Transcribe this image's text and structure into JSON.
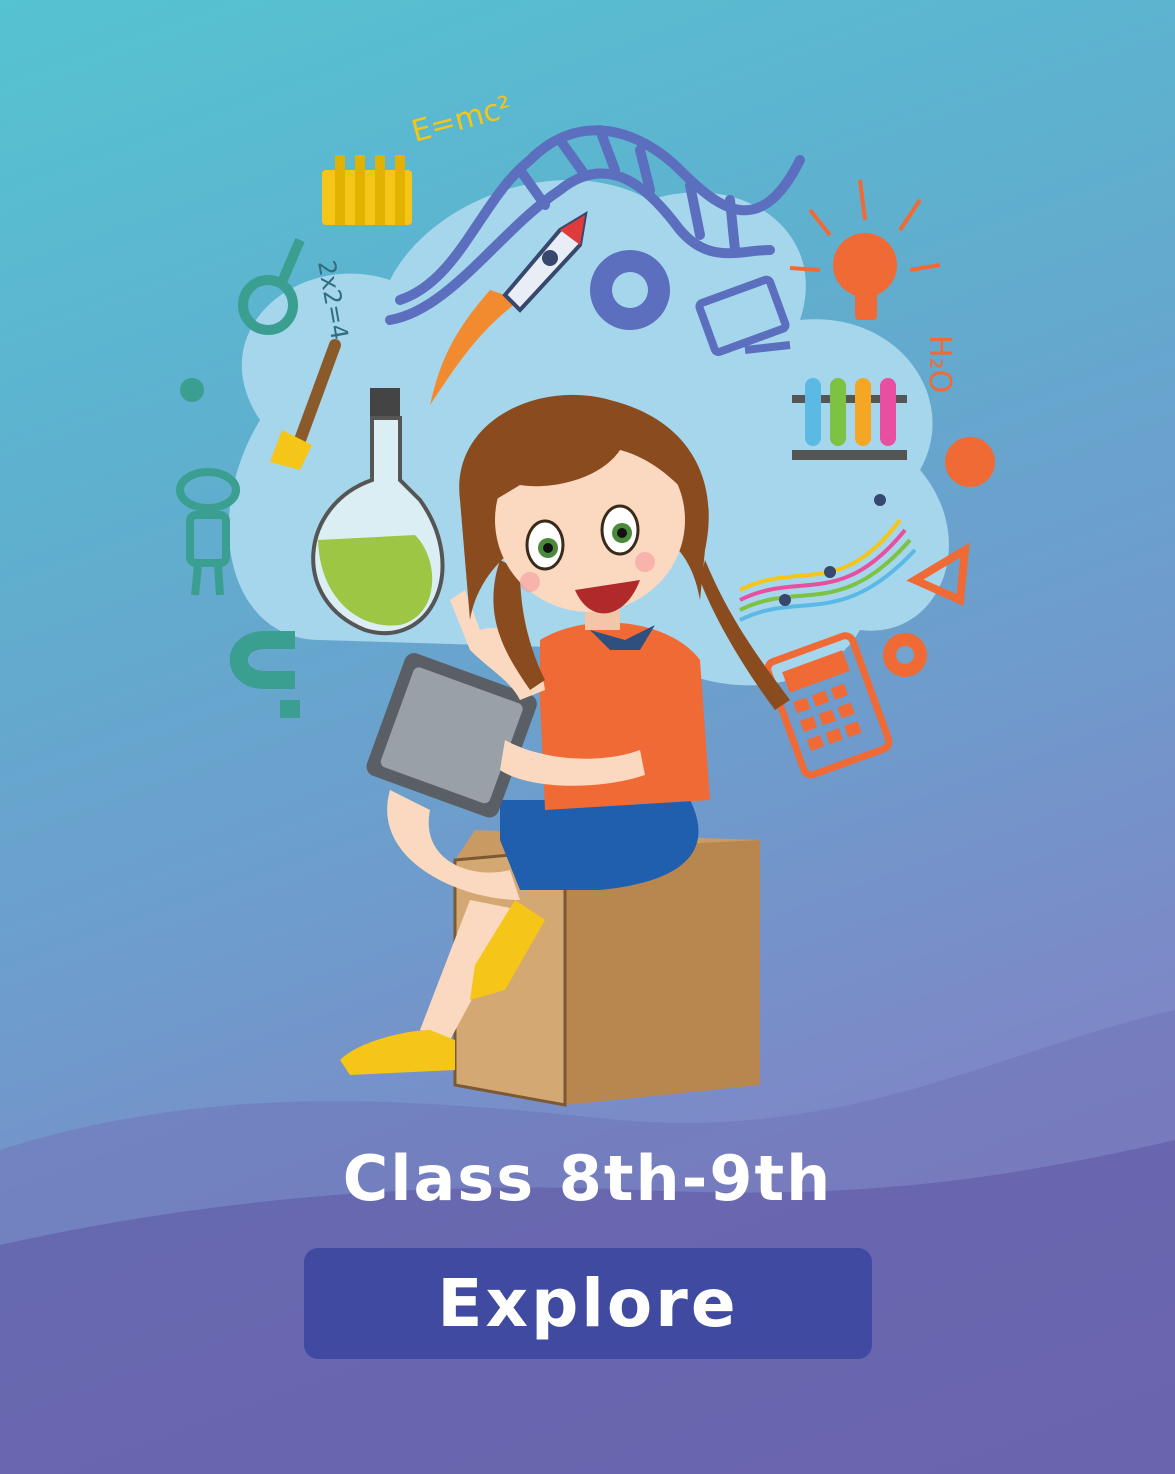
{
  "card": {
    "title": "Class 8th-9th",
    "button_label": "Explore",
    "formula_text": "E=mc²",
    "math_text": "2x2=4",
    "chem_text": "H₂O"
  },
  "colors": {
    "background_top": "#55c3d1",
    "background_bottom": "#8b79c2",
    "button": "#3f4aa0",
    "accent_orange": "#f06a35",
    "accent_yellow": "#f5c518"
  },
  "icons": [
    "dna-icon",
    "rocket-icon",
    "gear-icon",
    "monitor-icon",
    "lightbulb-icon",
    "test-tubes-icon",
    "flask-icon",
    "magnifier-icon",
    "paintbrush-icon",
    "robot-icon",
    "magnet-icon",
    "calculator-icon",
    "music-notes-icon",
    "triangle-icon",
    "abacus-icon"
  ]
}
